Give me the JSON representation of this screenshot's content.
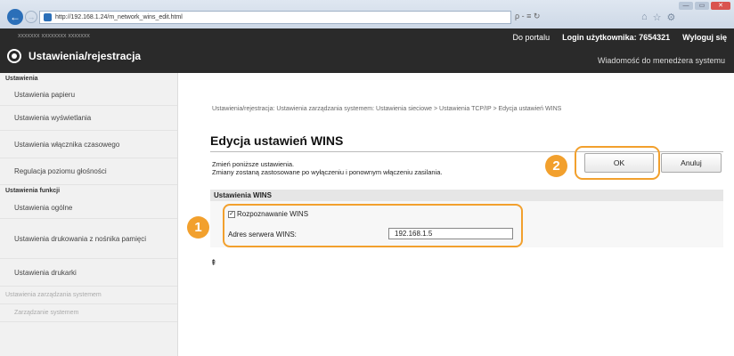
{
  "browser": {
    "url": "http://192.168.1.24/m_network_wins_edit.html",
    "addr_tools": "ρ - ≡ ↻",
    "tab_icons": [
      "⌂",
      "☆",
      "⚙"
    ],
    "win_controls": [
      "—",
      "▭",
      "✕"
    ]
  },
  "header": {
    "left_hint": "xxxxxxx   xxxxxxxx   xxxxxxx",
    "portal_link": "Do portalu",
    "login_label": "Login użytkownika:",
    "login_value": "7654321",
    "logout": "Wyloguj się",
    "app_title": "Ustawienia/rejestracja",
    "msg_link": "Wiadomość do menedżera systemu"
  },
  "sidebar": {
    "sec1": "Ustawienia",
    "items1": [
      "Ustawienia papieru",
      "Ustawienia wyświetlania",
      "Ustawienia włącznika czasowego",
      "Regulacja poziomu głośności"
    ],
    "sec2": "Ustawienia funkcji",
    "items2": [
      "Ustawienia ogólne",
      "Ustawienia drukowania z nośnika pamięci",
      "Ustawienia drukarki"
    ],
    "sec3": "Ustawienia zarządzania systemem",
    "item3": "Zarządzanie systemem"
  },
  "main": {
    "breadcrumb": "Ustawienia/rejestracja: Ustawienia zarządzania systemem: Ustawienia sieciowe > Ustawienia TCP/IP > Edycja ustawień WINS",
    "title": "Edycja ustawień WINS",
    "instr1": "Zmień poniższe ustawienia.",
    "instr2": "Zmiany zostaną zastosowane po wyłączeniu i ponownym włączeniu zasilania.",
    "ok": "OK",
    "cancel": "Anuluj",
    "section": "Ustawienia WINS",
    "checkbox_label": "Rozpoznawanie WINS",
    "checkbox_checked": true,
    "server_label": "Adres serwera WINS:",
    "server_value": "192.168.1.5",
    "to_top": "⇞"
  },
  "badges": [
    "1",
    "2"
  ],
  "colors": {
    "accent": "#f2a02d",
    "header": "#2a2a2a"
  }
}
